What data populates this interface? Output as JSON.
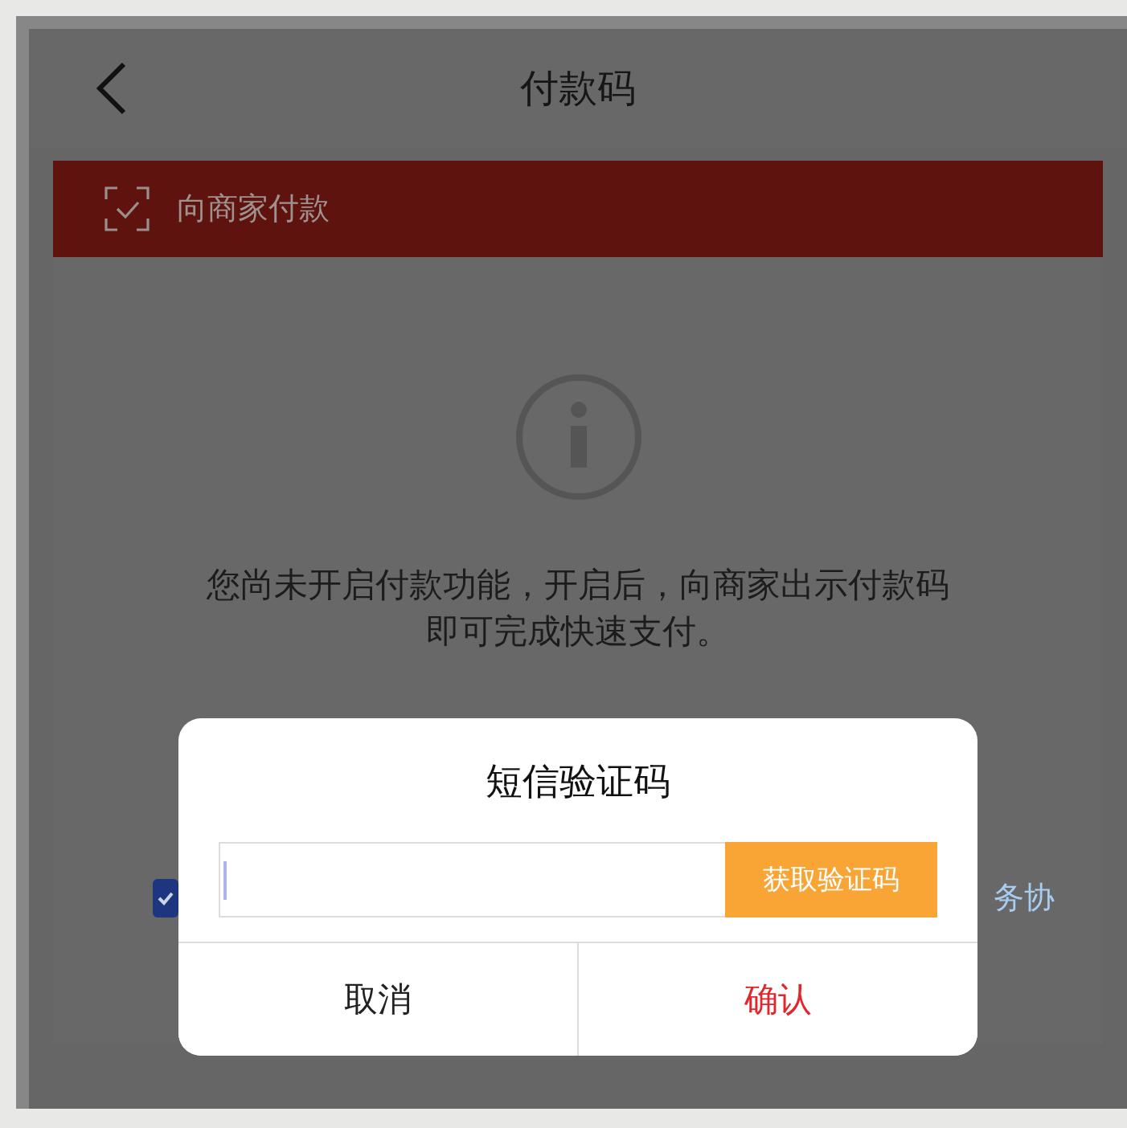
{
  "header": {
    "title": "付款码"
  },
  "banner": {
    "label": "向商家付款"
  },
  "notice": {
    "text": "您尚未开启付款功能，开启后，向商家出示付款码即可完成快速支付。"
  },
  "agreement": {
    "checked": true,
    "text": "务协"
  },
  "dialog": {
    "title": "短信验证码",
    "code_field": {
      "focused": true
    },
    "get_code_button": "获取验证码",
    "buttons": [
      {
        "label": "取消",
        "kind": "cancel"
      },
      {
        "label": "确认",
        "kind": "confirm"
      }
    ]
  }
}
